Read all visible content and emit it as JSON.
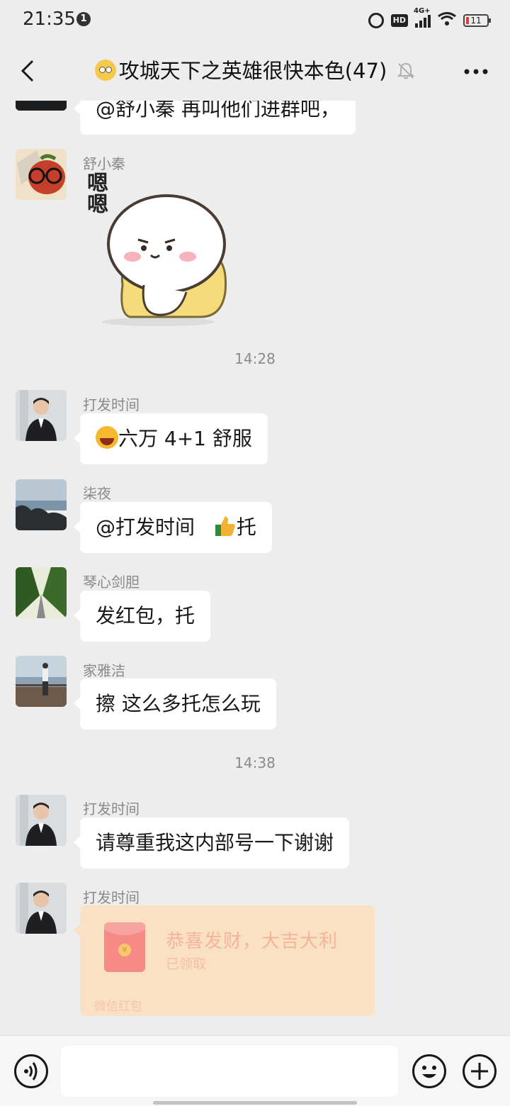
{
  "status_bar": {
    "time": "21:35",
    "notification_count": "1",
    "hd": "HD",
    "network": "4G+",
    "battery": "11"
  },
  "header": {
    "title": "攻城天下之英雄很快本色(47)"
  },
  "messages": [
    {
      "type": "text",
      "text": "@舒小秦   再叫他们进群吧，"
    },
    {
      "type": "sticker",
      "sender": "舒小秦",
      "sticker_text": "嗯嗯"
    },
    {
      "type": "time",
      "text": "14:28"
    },
    {
      "type": "text",
      "sender": "打发时间",
      "text": "六万 4+1 舒服"
    },
    {
      "type": "text",
      "sender": "柒夜",
      "text": "@打发时间 ",
      "suffix": "托"
    },
    {
      "type": "text",
      "sender": "琴心剑胆",
      "text": "发红包，托"
    },
    {
      "type": "text",
      "sender": "家雅洁",
      "text": "擦   这么多托怎么玩"
    },
    {
      "type": "time",
      "text": "14:38"
    },
    {
      "type": "text",
      "sender": "打发时间",
      "text": "请尊重我这内部号一下谢谢"
    },
    {
      "type": "red_packet",
      "sender": "打发时间",
      "title": "恭喜发财，大吉大利",
      "status": "已领取",
      "footer": "微信红包",
      "coin": "¥"
    }
  ],
  "icons": {
    "back": "back-arrow-icon",
    "mute": "bell-off-icon",
    "more": "more-dots-icon",
    "voice": "voice-icon",
    "emoji": "emoji-icon",
    "plus": "plus-icon"
  },
  "colors": {
    "background": "#ededed",
    "bubble": "#ffffff",
    "red_packet": "#fbe1c3",
    "meta_text": "#8a8a8a"
  }
}
